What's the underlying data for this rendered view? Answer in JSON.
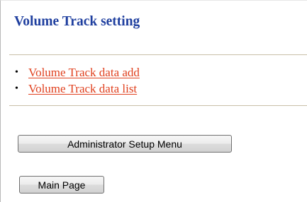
{
  "page": {
    "title": "Volume Track setting"
  },
  "links": [
    {
      "label": "Volume Track data add"
    },
    {
      "label": "Volume Track data list"
    }
  ],
  "buttons": {
    "admin_menu": "Administrator Setup Menu",
    "main_page": "Main Page"
  },
  "colors": {
    "title": "#1f3f9f",
    "link": "#e0401e",
    "rule": "#c9bfa8"
  }
}
